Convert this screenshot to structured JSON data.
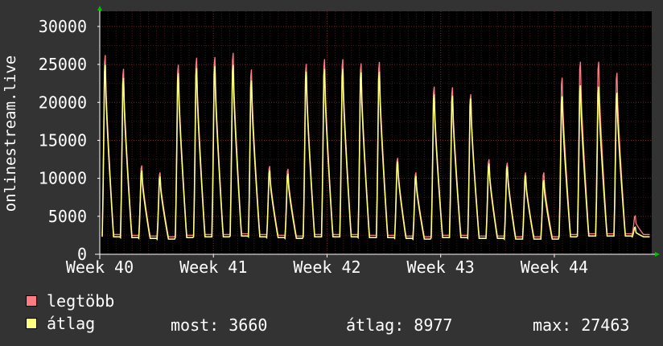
{
  "colors": {
    "background": "#333333",
    "plot_background": "#000000",
    "grid_major": "#7a2020",
    "grid_minor": "#3a1a1a",
    "text": "#ffffff",
    "series_max": "#ff7b82",
    "series_avg": "#ffff80",
    "axis_arrow": "#00c000"
  },
  "chart_data": {
    "type": "area",
    "ylabel": "onlinestream.live",
    "ylim": [
      0,
      32000
    ],
    "yticks": [
      0,
      5000,
      10000,
      15000,
      20000,
      25000,
      30000
    ],
    "x_ticks": [
      "Week 40",
      "Week 41",
      "Week 42",
      "Week 43",
      "Week 44"
    ],
    "grid": true,
    "legend_placement": "bottom-left",
    "days": 34,
    "series": [
      {
        "name": "legtöbb",
        "peaks": [
          28800,
          26800,
          12700,
          11700,
          27400,
          28400,
          28500,
          29100,
          26700,
          12600,
          12200,
          27500,
          28200,
          28200,
          27600,
          27800,
          13800,
          11700,
          24200,
          24100,
          23100,
          13600,
          13100,
          11700,
          11700,
          25500,
          27800,
          27800,
          26200,
          5300
        ],
        "troughs": [
          2600,
          2500,
          2400,
          2300,
          2500,
          2600,
          2600,
          2700,
          2600,
          2500,
          2400,
          2600,
          2600,
          2600,
          2500,
          2500,
          2400,
          2300,
          2500,
          2500,
          2400,
          2400,
          2300,
          2300,
          2300,
          2600,
          2700,
          2700,
          2700,
          2600
        ]
      },
      {
        "name": "átlag",
        "peaks": [
          27400,
          25500,
          12000,
          11100,
          26200,
          26900,
          27200,
          27400,
          25100,
          12000,
          11500,
          26400,
          26800,
          26800,
          26300,
          26400,
          13300,
          11200,
          23100,
          22900,
          22500,
          13000,
          12600,
          11300,
          10600,
          22800,
          24400,
          24200,
          23300,
          3700
        ],
        "troughs": [
          2300,
          2200,
          2100,
          2000,
          2200,
          2300,
          2300,
          2400,
          2300,
          2200,
          2100,
          2300,
          2300,
          2300,
          2200,
          2200,
          2100,
          2000,
          2200,
          2200,
          2100,
          2100,
          2000,
          2000,
          2000,
          2300,
          2400,
          2400,
          2400,
          2300
        ]
      }
    ]
  },
  "legend": {
    "max_label": "legtöbb",
    "avg_label": "átlag"
  },
  "stats": {
    "now": "most: 3660",
    "avg": "átlag: 8977",
    "max": "max: 27463"
  }
}
